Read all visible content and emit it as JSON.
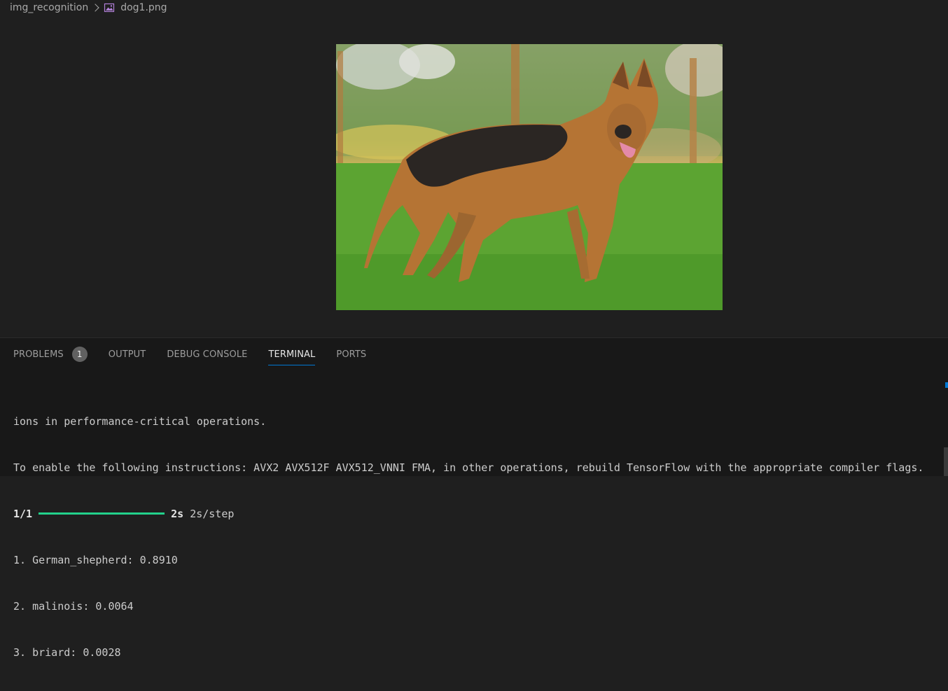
{
  "breadcrumb": {
    "folder": "img_recognition",
    "file": "dog1.png",
    "file_icon": "image-file-icon"
  },
  "image_viewer": {
    "description_icon": "german-shepherd-photo"
  },
  "panel": {
    "tabs": [
      {
        "label": "PROBLEMS",
        "badge": "1"
      },
      {
        "label": "OUTPUT"
      },
      {
        "label": "DEBUG CONSOLE"
      },
      {
        "label": "TERMINAL"
      },
      {
        "label": "PORTS"
      }
    ],
    "active_tab": "TERMINAL"
  },
  "terminal": {
    "line1": "ions in performance-critical operations.",
    "line2": "To enable the following instructions: AVX2 AVX512F AVX512_VNNI FMA, in other operations, rebuild TensorFlow with the appropriate compiler flags.",
    "progress": {
      "steps": "1/1",
      "fraction": 1.0,
      "time": "2s",
      "rate": "2s/step"
    },
    "predictions": [
      "1. German_shepherd: 0.8910",
      "2. malinois: 0.0064",
      "3. briard: 0.0028"
    ]
  },
  "colors": {
    "progress_bar": "#23d18b",
    "accent": "#0078d4"
  }
}
